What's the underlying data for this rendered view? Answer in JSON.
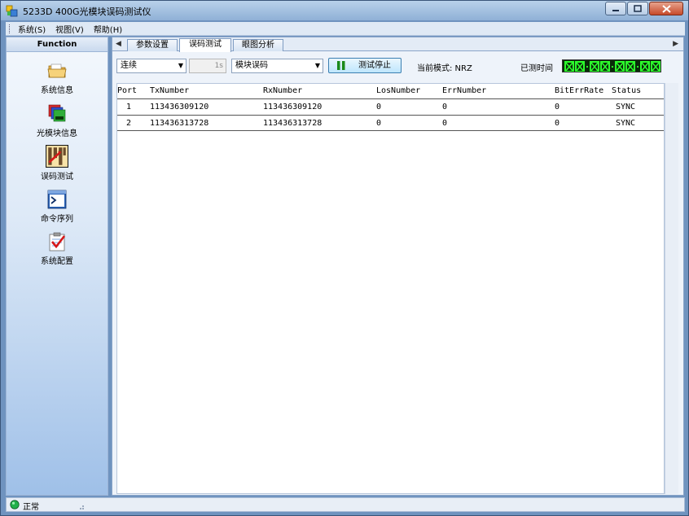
{
  "window": {
    "title": "5233D 400G光模块误码测试仪"
  },
  "menu": {
    "items": [
      "系统(S)",
      "视图(V)",
      "帮助(H)"
    ]
  },
  "sidebar": {
    "header": "Function",
    "items": [
      {
        "label": "系统信息",
        "icon": "folder-icon"
      },
      {
        "label": "光模块信息",
        "icon": "module-stack-icon"
      },
      {
        "label": "误码测试",
        "icon": "ber-test-icon"
      },
      {
        "label": "命令序列",
        "icon": "command-prompt-icon"
      },
      {
        "label": "系统配置",
        "icon": "clipboard-check-icon"
      }
    ]
  },
  "tabs": {
    "items": [
      {
        "label": "参数设置",
        "active": false
      },
      {
        "label": "误码测试",
        "active": true
      },
      {
        "label": "眼图分析",
        "active": false
      }
    ]
  },
  "toolbar": {
    "mode_select": "连续",
    "duration_value": "1s",
    "test_type_select": "模块误码",
    "stop_button": "测试停止",
    "current_mode": "当前模式: NRZ",
    "elapsed_label": "已测时间"
  },
  "table": {
    "columns": [
      "Port",
      "TxNumber",
      "RxNumber",
      "LosNumber",
      "ErrNumber",
      "BitErrRate",
      "Status"
    ],
    "rows": [
      [
        "1",
        "113436309120",
        "113436309120",
        "0",
        "0",
        "0",
        "SYNC"
      ],
      [
        "2",
        "113436313728",
        "113436313728",
        "0",
        "0",
        "0",
        "SYNC"
      ]
    ]
  },
  "status": {
    "text": "正常"
  },
  "colors": {
    "accent": "#6f93bf",
    "lcd_on": "#2cff2c",
    "status_ok": "#22b14c"
  }
}
